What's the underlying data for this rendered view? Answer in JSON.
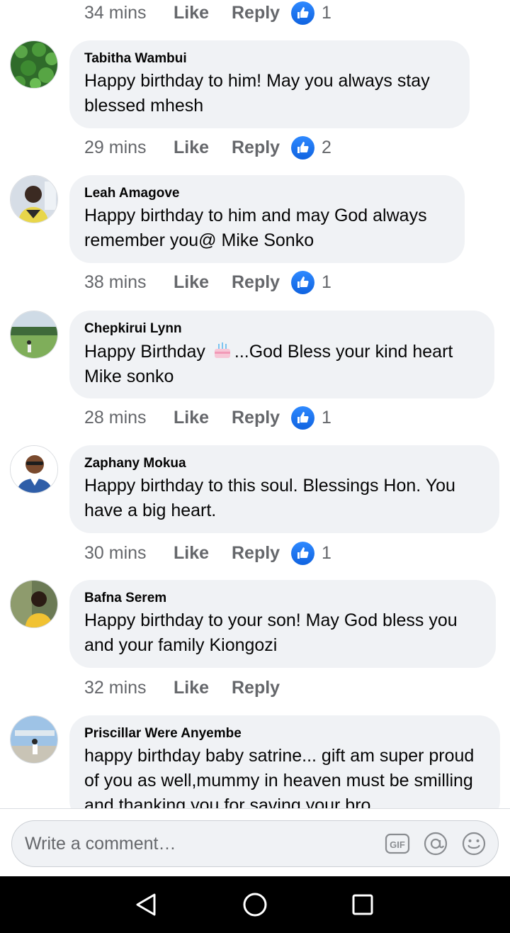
{
  "top_row": {
    "time": "34 mins",
    "like_label": "Like",
    "reply_label": "Reply",
    "reaction_count": "1"
  },
  "comments": [
    {
      "author": "Tabitha Wambui",
      "text": "Happy birthday to him! May you always stay blessed mhesh",
      "time": "29 mins",
      "like_label": "Like",
      "reply_label": "Reply",
      "reaction_count": "2",
      "avatar_icon": "avatar-plant-photo"
    },
    {
      "author": "Leah Amagove",
      "text": "Happy birthday to him and may God always remember you@ Mike Sonko",
      "time": "38 mins",
      "like_label": "Like",
      "reply_label": "Reply",
      "reaction_count": "1",
      "avatar_icon": "avatar-person-photo"
    },
    {
      "author": "Chepkirui Lynn",
      "text_before": "Happy Birthday ",
      "text_after": "...God Bless  your kind heart Mike sonko",
      "emoji": "birthday-cake-emoji",
      "time": "28 mins",
      "like_label": "Like",
      "reply_label": "Reply",
      "reaction_count": "1",
      "avatar_icon": "avatar-field-photo"
    },
    {
      "author": "Zaphany Mokua",
      "text": "Happy birthday to this soul. Blessings Hon. You have a big heart.",
      "time": "30 mins",
      "like_label": "Like",
      "reply_label": "Reply",
      "reaction_count": "1",
      "avatar_icon": "avatar-cartoon-portrait"
    },
    {
      "author": "Bafna Serem",
      "text": "Happy birthday to your son! May God bless you and your family Kiongozi",
      "time": "32 mins",
      "like_label": "Like",
      "reply_label": "Reply",
      "avatar_icon": "avatar-person-photo"
    },
    {
      "author": "Priscillar Were Anyembe",
      "text": "happy birthday baby satrine... gift am super proud of you as well,mummy in heaven must be smilling and thanking you for saving your bro",
      "avatar_icon": "avatar-outdoor-photo"
    }
  ],
  "composer": {
    "placeholder": "Write a comment…",
    "gif_label": "GIF"
  },
  "colors": {
    "like_blue": "#1877f2",
    "bubble_bg": "#f0f2f5",
    "meta_gray": "#65676b"
  },
  "nav_icons": [
    "back-triangle-icon",
    "home-circle-icon",
    "recents-square-icon"
  ]
}
